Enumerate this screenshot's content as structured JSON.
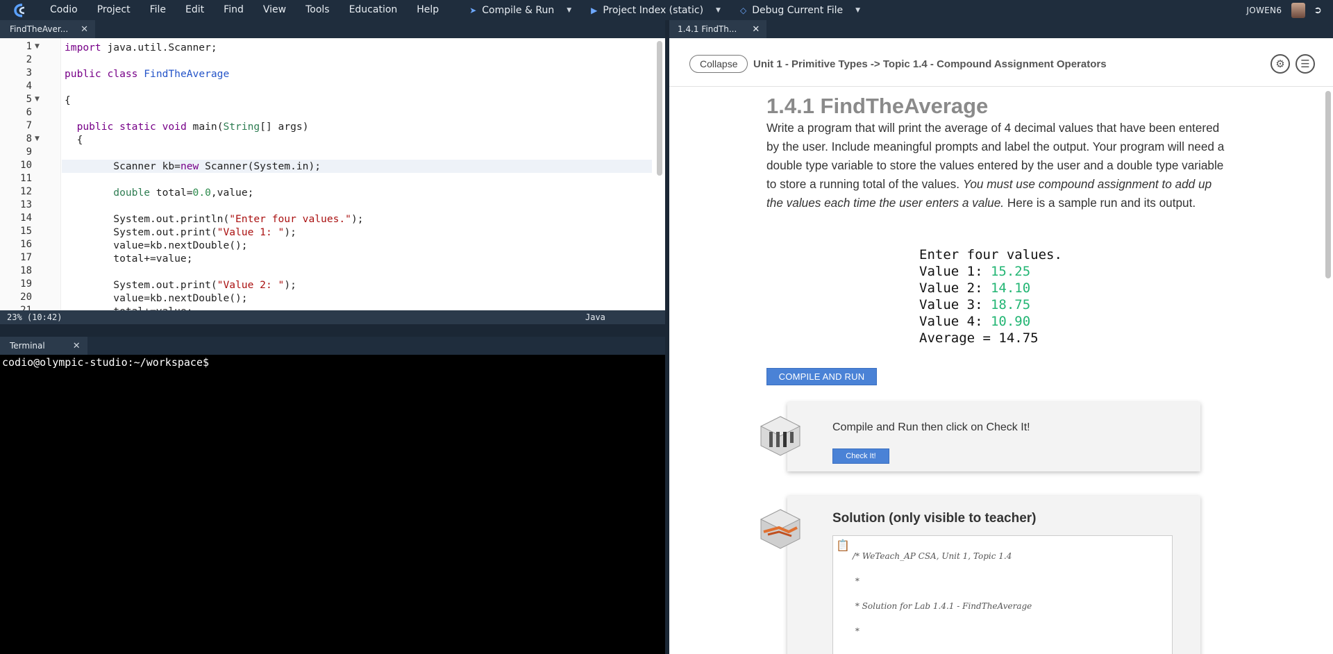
{
  "menubar": {
    "items": [
      "Codio",
      "Project",
      "File",
      "Edit",
      "Find",
      "View",
      "Tools",
      "Education",
      "Help"
    ],
    "compile_run": "Compile & Run",
    "project_index": "Project Index (static)",
    "debug_file": "Debug Current File",
    "user": "JOWEN6"
  },
  "editor": {
    "tab_label": "FindTheAver...",
    "line_numbers": [
      "1",
      "2",
      "3",
      "4",
      "5",
      "6",
      "7",
      "8",
      "9",
      "10",
      "11",
      "12",
      "13",
      "14",
      "15",
      "16",
      "17",
      "18",
      "19",
      "20",
      "21"
    ],
    "status_position": "23%  (10:42)",
    "status_language": "Java"
  },
  "terminal": {
    "tab_label": "Terminal",
    "prompt": "codio@olympic-studio:~/workspace$"
  },
  "guide": {
    "tab_label": "1.4.1 FindTh...",
    "collapse_label": "Collapse",
    "breadcrumb": "Unit 1 - Primitive Types -> Topic 1.4 - Compound Assignment Operators",
    "title": "1.4.1 FindTheAverage",
    "desc_part1": "Write a program that will print the average of 4 decimal values that have been entered by the user. Include meaningful prompts and label the output. Your program will need a double type variable to store the values entered by the user and a double type variable to store a running total of the values. ",
    "desc_italic": "You must use compound assignment to add up the values each time the user enters a value.",
    "desc_part2": " Here is a sample run and its output.",
    "sample": {
      "line1": "Enter four values.",
      "prompts": [
        "Value 1: ",
        "Value 2: ",
        "Value 3: ",
        "Value 4: "
      ],
      "values": [
        "15.25",
        "14.10",
        "18.75",
        "10.90"
      ],
      "average": "Average = 14.75"
    },
    "compile_button": "COMPILE AND RUN",
    "check_text": "Compile and Run then click on Check It!",
    "check_button": "Check It!",
    "solution_title": "Solution (only visible to teacher)",
    "solution_lines": [
      "/* WeTeach_AP CSA, Unit 1, Topic 1.4",
      " *",
      " * Solution for Lab 1.4.1 - FindTheAverage",
      " *"
    ]
  }
}
